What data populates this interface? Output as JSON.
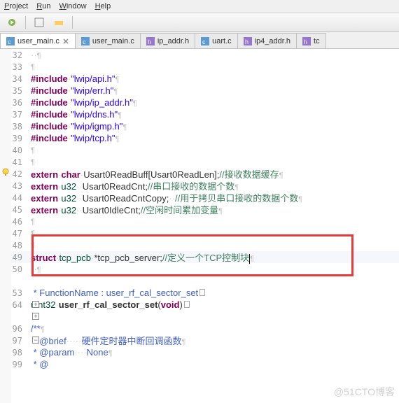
{
  "menu": {
    "items": [
      "Project",
      "Run",
      "Window",
      "Help"
    ]
  },
  "tabs": [
    {
      "label": "user_main.c",
      "icon": "c-file-icon",
      "active": true,
      "closeable": true
    },
    {
      "label": "user_main.c",
      "icon": "c-file-icon",
      "active": false,
      "closeable": false
    },
    {
      "label": "ip_addr.h",
      "icon": "h-file-icon",
      "active": false,
      "closeable": false
    },
    {
      "label": "uart.c",
      "icon": "c-file-icon",
      "active": false,
      "closeable": false
    },
    {
      "label": "ip4_addr.h",
      "icon": "h-file-icon",
      "active": false,
      "closeable": false
    },
    {
      "label": "tc",
      "icon": "h-file-icon",
      "active": false,
      "closeable": false
    }
  ],
  "lines": {
    "32": {
      "ws": "··",
      "para": "¶"
    },
    "33": {
      "para": "¶"
    },
    "34": {
      "kw": "#include",
      "ws": "·",
      "str": "\"lwip/api.h\"",
      "para": "¶"
    },
    "35": {
      "kw": "#include",
      "ws": "·",
      "str": "\"lwip/err.h\"",
      "para": "¶"
    },
    "36": {
      "kw": "#include",
      "ws": "·",
      "str": "\"lwip/ip_addr.h\"",
      "para": "¶"
    },
    "37": {
      "kw": "#include",
      "ws": "·",
      "str": "\"lwip/dns.h\"",
      "para": "¶"
    },
    "38": {
      "kw": "#include",
      "ws": "·",
      "str": "\"lwip/igmp.h\"",
      "para": "¶"
    },
    "39": {
      "kw": "#include",
      "ws": "·",
      "str": "\"lwip/tcp.h\"",
      "para": "¶"
    },
    "40": {
      "para": "¶"
    },
    "41": {
      "para": "¶"
    },
    "42": {
      "kw1": "extern",
      "kw2": "char",
      "var": "Usart0ReadBuff[Usart0ReadLen];",
      "cmt": "//接收数据缓存"
    },
    "43": {
      "kw1": "extern",
      "typ": "u32",
      "ws": "··",
      "var": "Usart0ReadCnt;",
      "cmt": "//串口接收的数据个数"
    },
    "44": {
      "kw1": "extern",
      "typ": "u32",
      "ws": "··",
      "var": "Usart0ReadCntCopy;",
      "ws2": "··",
      "cmt": "//用于拷贝串口接收的数据个数"
    },
    "45": {
      "kw1": "extern",
      "typ": "u32",
      "ws": "··",
      "var": "Usart0IdleCnt;",
      "cmt": "//空闲时间累加变量"
    },
    "46": {
      "para": "¶"
    },
    "47": {
      "para": "¶"
    },
    "48": {
      "para": "¶"
    },
    "49": {
      "kw": "struct",
      "typ": "tcp_pcb",
      "var": "*tcp_pcb_server;",
      "cmt": "//定义一个TCP控制块"
    },
    "50": {
      "ws": "··",
      "para": "¶"
    },
    "blank": "",
    "53": {
      "cmt": " * FunctionName : user_rf_cal_sector_set"
    },
    "64": {
      "typ": "uint32",
      "fn": "user_rf_cal_sector_set",
      "rest": "(",
      "kw": "void",
      "rest2": ")"
    },
    "blank2": "",
    "96": {
      "cmt": "/**"
    },
    "97": {
      "cmt1": " * @brief",
      "ws": "·····",
      "cmt2": "硬件定时器中断回调函数"
    },
    "98": {
      "cmt1": " * @param",
      "ws": "····",
      "cmt2": "None"
    },
    "99": {
      "cmt": " * @"
    }
  },
  "watermark": "@51CTO博客"
}
